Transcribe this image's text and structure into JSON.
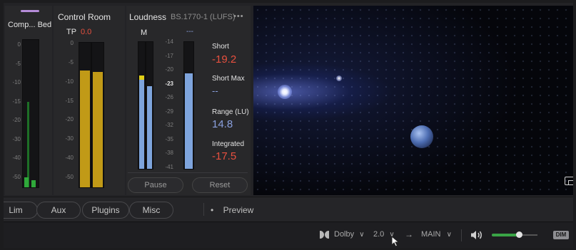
{
  "meters": {
    "comp": {
      "title": "Comp... Bed",
      "accent_color": "#b58cd8",
      "scale": [
        "0",
        "-5",
        "-10",
        "-15",
        "-20",
        "-30",
        "-40",
        "-50"
      ],
      "level_fraction": 0.07
    },
    "control_room": {
      "title": "Control Room",
      "tp_label": "TP",
      "tp_value": "0.0",
      "scale": [
        "0",
        "-5",
        "-10",
        "-15",
        "-20",
        "-30",
        "-40",
        "-50"
      ],
      "left_level_fraction": 0.81,
      "right_level_fraction": 0.8
    },
    "loudness": {
      "title": "Loudness",
      "standard": "BS.1770-1 (LUFS)",
      "menu_icon": "more-dots-icon",
      "menu_glyph": "•••",
      "m_label": "M",
      "dash_label": "---",
      "scale": [
        "-14",
        "-17",
        "-20",
        "-23",
        "-26",
        "-29",
        "-32",
        "-35",
        "-38",
        "-41"
      ],
      "highlight_tick": "-23",
      "m_left_level_fraction": 0.7,
      "m_right_level_fraction": 0.65,
      "short_level_fraction": 0.75,
      "short_label": "Short",
      "short_value": "-19.2",
      "short_max_label": "Short Max",
      "short_max_value": "--",
      "range_label": "Range (LU)",
      "range_value": "14.8",
      "integrated_label": "Integrated",
      "integrated_value": "-17.5",
      "pause_label": "Pause",
      "reset_label": "Reset"
    }
  },
  "viewer": {
    "overlay_icon": "pip-window-icon"
  },
  "tabs": [
    {
      "label": "Lim"
    },
    {
      "label": "Aux"
    },
    {
      "label": "Plugins"
    },
    {
      "label": "Misc"
    }
  ],
  "preview": {
    "bullet": "•",
    "label": "Preview"
  },
  "bottom_bar": {
    "dolby_icon": "dolby-logo-icon",
    "dolby_label": "Dolby",
    "format_value": "2.0",
    "arrow_glyph": "→",
    "output_value": "MAIN",
    "chevron_glyph": "∨",
    "volume_icon": "speaker-icon",
    "volume_fraction": 0.6,
    "dim_label": "DIM"
  },
  "colors": {
    "red_value": "#e8503f",
    "blue_value": "#8aa0de",
    "meter_gold": "#c19a17",
    "meter_blue": "#7ea4dc",
    "meter_green": "#2fa83a",
    "meter_yellow": "#e0cf17",
    "volume_green": "#3aa446"
  }
}
